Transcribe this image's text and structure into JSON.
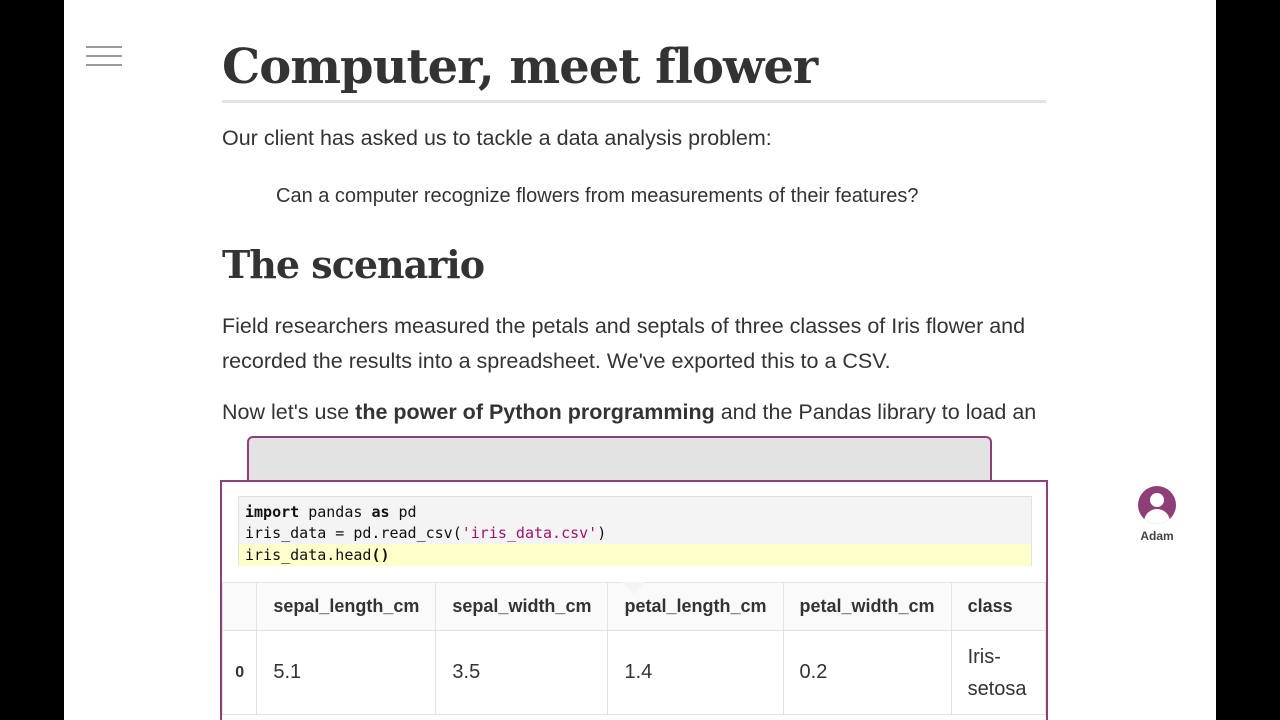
{
  "heading": "Computer, meet flower",
  "intro": "Our client has asked us to tackle a data analysis problem:",
  "quote": "Can a computer recognize flowers from measurements of their features?",
  "section_heading": "The scenario",
  "paragraph1": "Field researchers measured the petals and septals of three classes of Iris flower and recorded the results into a spreadsheet. We've exported this to a CSV.",
  "paragraph2": {
    "before": "Now let's use ",
    "bold": "the power of Python prorgramming",
    "after": " and the Pandas library to load an"
  },
  "code": {
    "line1": {
      "kw1": "import",
      "mid": " pandas ",
      "kw2": "as",
      "end": " pd"
    },
    "line2": {
      "start": "iris_data = pd.read_csv(",
      "str": "'iris_data.csv'",
      "end": ")"
    },
    "line3": {
      "start": "iris_data.head",
      "bold": "()"
    }
  },
  "table": {
    "columns": [
      "",
      "sepal_length_cm",
      "sepal_width_cm",
      "petal_length_cm",
      "petal_width_cm",
      "class"
    ],
    "rows": [
      {
        "index": "0",
        "sepal_length_cm": "5.1",
        "sepal_width_cm": "3.5",
        "petal_length_cm": "1.4",
        "petal_width_cm": "0.2",
        "class": "Iris-setosa"
      }
    ]
  },
  "user": {
    "name": "Adam",
    "icon": "user-avatar-icon",
    "color": "#8e3f78"
  },
  "colors": {
    "accent": "#8e3f78",
    "highlight": "#ffffcc",
    "string": "#a4116c"
  }
}
